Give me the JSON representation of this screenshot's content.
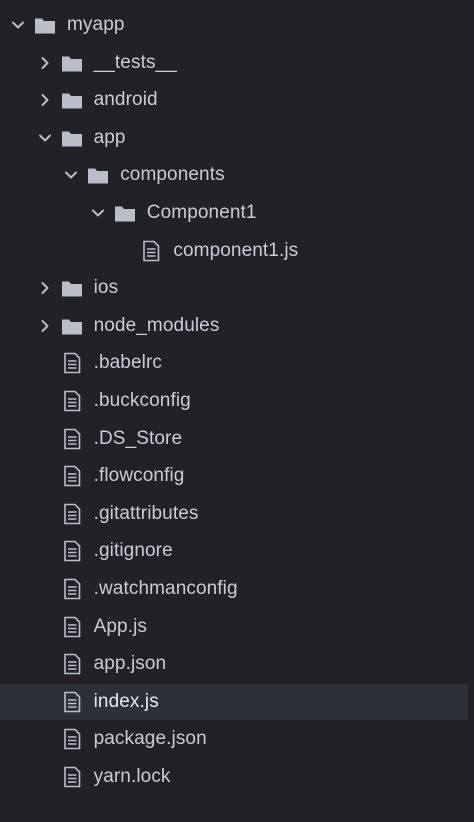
{
  "colors": {
    "background": "#202226",
    "selected_row": "#2d3037",
    "text": "#c8cdd6",
    "icon": "#b9bec8"
  },
  "tree": {
    "items": [
      {
        "label": "myapp",
        "kind": "folder",
        "expanded": true,
        "depth": 0
      },
      {
        "label": "__tests__",
        "kind": "folder",
        "expanded": false,
        "depth": 1
      },
      {
        "label": "android",
        "kind": "folder",
        "expanded": false,
        "depth": 1
      },
      {
        "label": "app",
        "kind": "folder",
        "expanded": true,
        "depth": 1
      },
      {
        "label": "components",
        "kind": "folder",
        "expanded": true,
        "depth": 2
      },
      {
        "label": "Component1",
        "kind": "folder",
        "expanded": true,
        "depth": 3
      },
      {
        "label": "component1.js",
        "kind": "file",
        "depth": 4
      },
      {
        "label": "ios",
        "kind": "folder",
        "expanded": false,
        "depth": 1
      },
      {
        "label": "node_modules",
        "kind": "folder",
        "expanded": false,
        "depth": 1
      },
      {
        "label": ".babelrc",
        "kind": "file",
        "depth": 1
      },
      {
        "label": ".buckconfig",
        "kind": "file",
        "depth": 1
      },
      {
        "label": ".DS_Store",
        "kind": "file",
        "depth": 1
      },
      {
        "label": ".flowconfig",
        "kind": "file",
        "depth": 1
      },
      {
        "label": ".gitattributes",
        "kind": "file",
        "depth": 1
      },
      {
        "label": ".gitignore",
        "kind": "file",
        "depth": 1
      },
      {
        "label": ".watchmanconfig",
        "kind": "file",
        "depth": 1
      },
      {
        "label": "App.js",
        "kind": "file",
        "depth": 1
      },
      {
        "label": "app.json",
        "kind": "file",
        "depth": 1
      },
      {
        "label": "index.js",
        "kind": "file",
        "depth": 1,
        "selected": true
      },
      {
        "label": "package.json",
        "kind": "file",
        "depth": 1
      },
      {
        "label": "yarn.lock",
        "kind": "file",
        "depth": 1
      }
    ]
  }
}
